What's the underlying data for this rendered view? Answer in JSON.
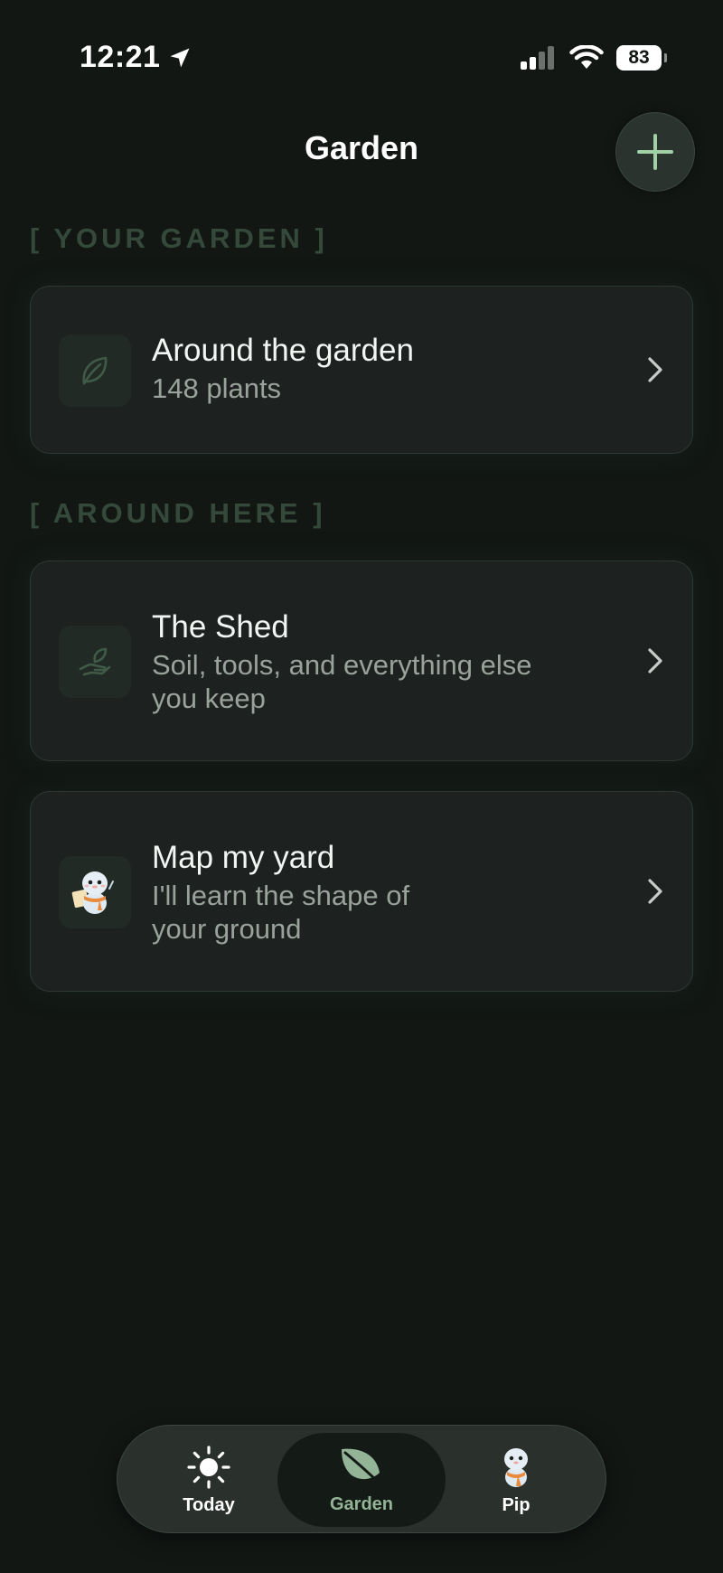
{
  "status_bar": {
    "time": "12:21",
    "battery": "83",
    "icons": [
      "location-arrow-icon",
      "signal-icon",
      "wifi-icon",
      "battery-icon"
    ]
  },
  "header": {
    "title": "Garden",
    "add_icon": "plus-icon"
  },
  "sections": {
    "your_garden": {
      "label": "[ YOUR GARDEN ]",
      "card": {
        "title": "Around the garden",
        "subtitle": "148 plants",
        "icon": "leaf-icon"
      }
    },
    "around_here": {
      "label": "[ AROUND HERE ]",
      "cards": [
        {
          "title": "The Shed",
          "subtitle_line1": "Soil, tools, and everything else",
          "subtitle_line2": "you keep",
          "icon": "hand-holding-plant-icon"
        },
        {
          "title": "Map my yard",
          "subtitle_line1": "I'll learn the shape of",
          "subtitle_line2": "your ground",
          "icon": "mascot-map-icon"
        }
      ]
    }
  },
  "tab_bar": {
    "active": "Garden",
    "tabs": [
      {
        "label": "Today",
        "icon": "sun-icon"
      },
      {
        "label": "Garden",
        "icon": "leaf-icon"
      },
      {
        "label": "Pip",
        "icon": "mascot-icon"
      }
    ]
  },
  "colors": {
    "background": "#121714",
    "card": "#1d2220",
    "section_label": "#34493a",
    "accent_green": "#93b496",
    "subtitle": "#9aa29c"
  }
}
